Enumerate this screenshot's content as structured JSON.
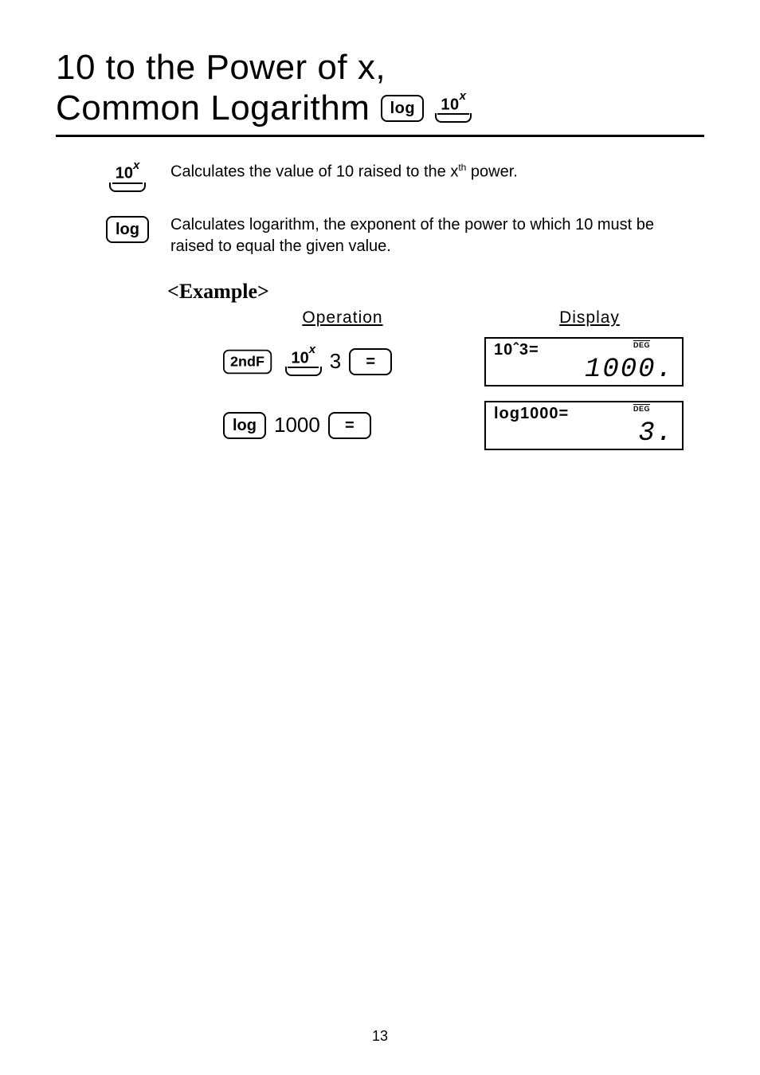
{
  "title": {
    "line1": "10 to the Power of x,",
    "line2": "Common Logarithm"
  },
  "keys": {
    "log": "log",
    "tenx_html": "10<sup>x</sup>",
    "secondF": "2ndF",
    "equals": "="
  },
  "descriptions": {
    "tenx_html": "Calculates the value of 10 raised to the x<sup class='th'>th</sup> power.",
    "log": "Calculates logarithm, the exponent of the power to which 10 must be raised to equal the given value."
  },
  "example": {
    "heading": "<Example>",
    "col_operation": "Operation",
    "col_display": "Display",
    "rows": [
      {
        "op_number": "3",
        "lcd_expr": "10ˆ3=",
        "lcd_mode": "DEG",
        "lcd_result": "1000."
      },
      {
        "op_number": "1000",
        "lcd_expr": "log1000=",
        "lcd_mode": "DEG",
        "lcd_result": "3."
      }
    ]
  },
  "page_number": "13"
}
